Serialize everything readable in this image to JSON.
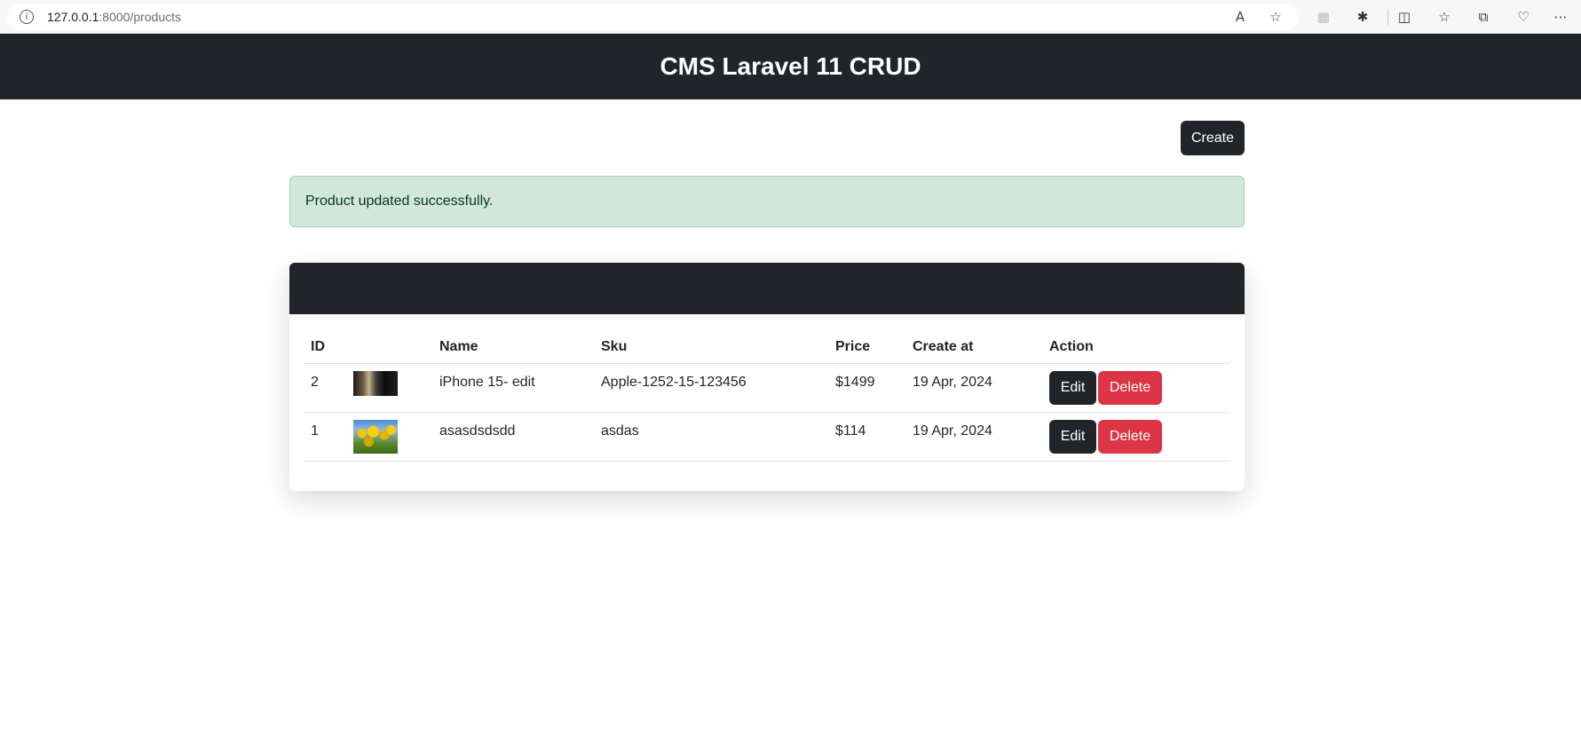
{
  "browser": {
    "url_host": "127.0.0.1",
    "url_path": ":8000/products",
    "icons": [
      "info-icon",
      "read-aloud-icon",
      "favorite-star-icon",
      "extension-icon",
      "puzzle-icon",
      "split-screen-icon",
      "favorites-icon",
      "collections-icon",
      "performance-icon",
      "more-icon"
    ]
  },
  "header": {
    "title": "CMS Laravel 11 CRUD"
  },
  "toolbar": {
    "create_label": "Create"
  },
  "alert": {
    "message": "Product updated successfully."
  },
  "table": {
    "columns": [
      "ID",
      "",
      "Name",
      "Sku",
      "Price",
      "Create at",
      "Action"
    ],
    "rows": [
      {
        "id": "2",
        "image": "iphone-thumbnail",
        "name": "iPhone 15- edit",
        "sku": "Apple-1252-15-123456",
        "price": "$1499",
        "created": "19 Apr, 2024",
        "edit": "Edit",
        "delete": "Delete"
      },
      {
        "id": "1",
        "image": "tulips-thumbnail",
        "name": "asasdsdsdd",
        "sku": "asdas",
        "price": "$114",
        "created": "19 Apr, 2024",
        "edit": "Edit",
        "delete": "Delete"
      }
    ]
  },
  "colors": {
    "dark": "#212529",
    "danger": "#dc3545",
    "alert_bg": "#d1e7dd"
  }
}
